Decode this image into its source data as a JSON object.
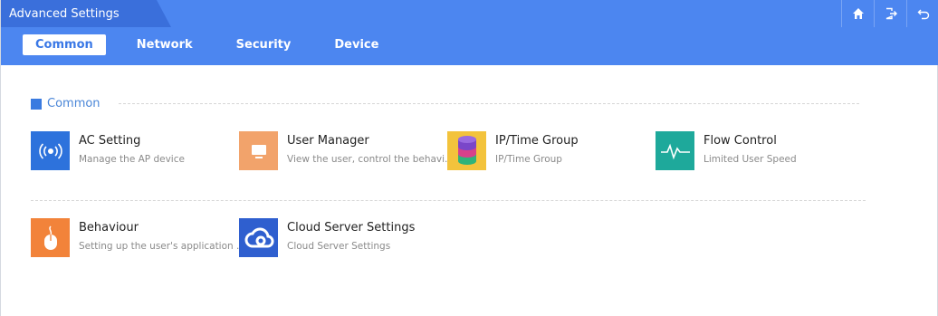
{
  "header": {
    "title": "Advanced Settings",
    "accent_color": "#4c86f0",
    "icons": [
      "home-icon",
      "logout-icon",
      "back-icon"
    ]
  },
  "tabs": [
    {
      "label": "Common",
      "active": true
    },
    {
      "label": "Network",
      "active": false
    },
    {
      "label": "Security",
      "active": false
    },
    {
      "label": "Device",
      "active": false
    }
  ],
  "section": {
    "label": "Common"
  },
  "items": [
    {
      "title": "AC Setting",
      "desc": "Manage the AP device",
      "icon": "ac-signal-icon",
      "color": "#2d72dc"
    },
    {
      "title": "User Manager",
      "desc": "View the user, control the behavi...",
      "icon": "monitor-icon",
      "color": "#f2a36b"
    },
    {
      "title": "IP/Time Group",
      "desc": "IP/Time Group",
      "icon": "database-stack-icon",
      "color": "#f3c33c"
    },
    {
      "title": "Flow Control",
      "desc": "Limited User Speed",
      "icon": "pulse-wave-icon",
      "color": "#1ea99b"
    },
    {
      "title": "Behaviour",
      "desc": "Setting up the user's application ...",
      "icon": "mouse-click-icon",
      "color": "#f2833a"
    },
    {
      "title": "Cloud Server Settings",
      "desc": "Cloud Server Settings",
      "icon": "cloud-icon",
      "color": "#2f5fcf"
    }
  ]
}
